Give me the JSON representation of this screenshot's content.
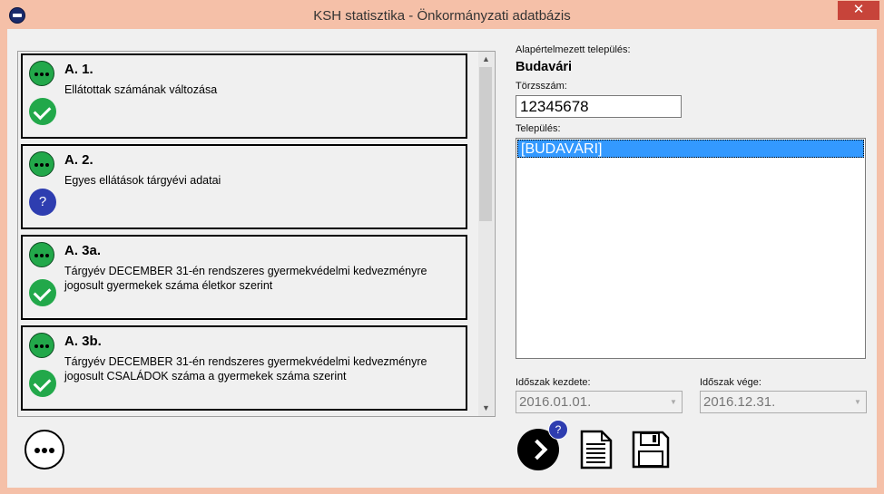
{
  "window": {
    "title": "KSH statisztika - Önkormányzati adatbázis",
    "close_label": "✕"
  },
  "forms": [
    {
      "code": "A. 1.",
      "description": "Ellátottak számának változása",
      "status": "done"
    },
    {
      "code": "A. 2.",
      "description": "Egyes ellátások tárgyévi adatai",
      "status": "unknown"
    },
    {
      "code": "A. 3a.",
      "description": "Tárgyév DECEMBER 31-én rendszeres gyermekvédelmi kedvezményre jogosult gyermekek száma életkor szerint",
      "status": "done"
    },
    {
      "code": "A. 3b.",
      "description": "Tárgyév DECEMBER 31-én rendszeres gyermekvédelmi kedvezményre jogosult CSALÁDOK száma a gyermekek száma szerint",
      "status": "done"
    }
  ],
  "status_glyphs": {
    "unknown": "?"
  },
  "settings": {
    "default_town_label": "Alapértelmezett település:",
    "default_town": "Budavári",
    "registry_label": "Törzsszám:",
    "registry_value": "12345678",
    "town_label": "Település:",
    "towns": [
      "[BUDAVÁRI]"
    ],
    "period_start_label": "Időszak kezdete:",
    "period_start": "2016.01.01.",
    "period_end_label": "Időszak vége:",
    "period_end": "2016.12.31."
  },
  "actions": {
    "help_badge": "?"
  },
  "icons": {
    "app": "ksh-app-icon",
    "more": "more-options-icon",
    "next": "next-arrow-icon",
    "document": "document-icon",
    "save": "floppy-disk-icon"
  },
  "colors": {
    "status_green": "#22a84a",
    "question_blue": "#2e3db0",
    "selection_blue": "#3399ff",
    "close_red": "#c7443a"
  }
}
